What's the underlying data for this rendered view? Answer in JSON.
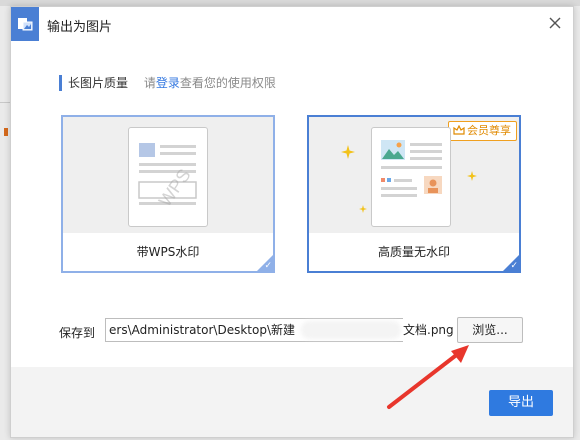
{
  "dialog": {
    "title": "输出为图片",
    "close_label": "×"
  },
  "quality": {
    "label": "长图片质量",
    "hint_prefix": "请",
    "hint_login": "登录",
    "hint_suffix": "查看您的使用权限"
  },
  "options": [
    {
      "label": "带WPS水印",
      "watermark_text": "WPS"
    },
    {
      "label": "高质量无水印",
      "badge": "会员尊享"
    }
  ],
  "save": {
    "label": "保存到",
    "path_value": "ers\\Administrator\\Desktop\\新建",
    "path_tail": "文档.png",
    "browse_label": "浏览..."
  },
  "footer": {
    "export_label": "导出"
  },
  "colors": {
    "accent": "#4a7fd4",
    "primary_button": "#2f7ae0",
    "badge": "#f0a020",
    "arrow": "#e8362c"
  }
}
